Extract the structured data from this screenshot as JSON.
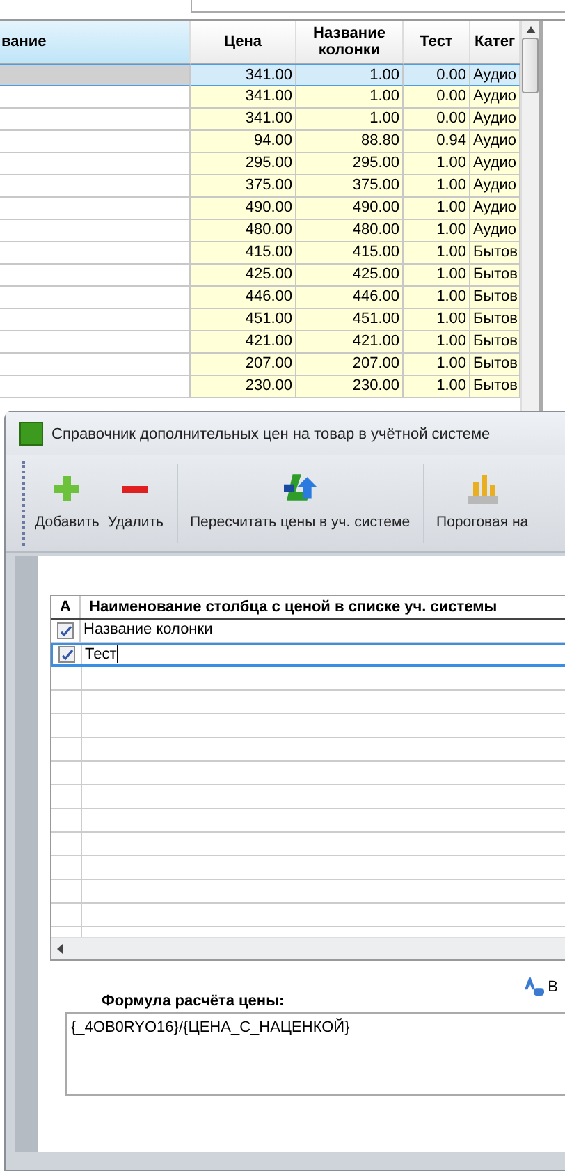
{
  "background_grid": {
    "columns": [
      {
        "label": "вание"
      },
      {
        "label": "Цена"
      },
      {
        "label": "Название колонки"
      },
      {
        "label": "Тест"
      },
      {
        "label": "Катег"
      }
    ],
    "rows": [
      {
        "selected": true,
        "cells": [
          "",
          "341.00",
          "1.00",
          "0.00",
          "Аудио"
        ]
      },
      {
        "selected": false,
        "cells": [
          "",
          "341.00",
          "1.00",
          "0.00",
          "Аудио"
        ]
      },
      {
        "selected": false,
        "cells": [
          "",
          "341.00",
          "1.00",
          "0.00",
          "Аудио"
        ]
      },
      {
        "selected": false,
        "cells": [
          "",
          "94.00",
          "88.80",
          "0.94",
          "Аудио"
        ]
      },
      {
        "selected": false,
        "cells": [
          "",
          "295.00",
          "295.00",
          "1.00",
          "Аудио"
        ]
      },
      {
        "selected": false,
        "cells": [
          "",
          "375.00",
          "375.00",
          "1.00",
          "Аудио"
        ]
      },
      {
        "selected": false,
        "cells": [
          "",
          "490.00",
          "490.00",
          "1.00",
          "Аудио"
        ]
      },
      {
        "selected": false,
        "cells": [
          "",
          "480.00",
          "480.00",
          "1.00",
          "Аудио"
        ]
      },
      {
        "selected": false,
        "cells": [
          "",
          "415.00",
          "415.00",
          "1.00",
          "Бытов"
        ]
      },
      {
        "selected": false,
        "cells": [
          "",
          "425.00",
          "425.00",
          "1.00",
          "Бытов"
        ]
      },
      {
        "selected": false,
        "cells": [
          "",
          "446.00",
          "446.00",
          "1.00",
          "Бытов"
        ]
      },
      {
        "selected": false,
        "cells": [
          "",
          "451.00",
          "451.00",
          "1.00",
          "Бытов"
        ]
      },
      {
        "selected": false,
        "cells": [
          "",
          "421.00",
          "421.00",
          "1.00",
          "Бытов"
        ]
      },
      {
        "selected": false,
        "cells": [
          "",
          "207.00",
          "207.00",
          "1.00",
          "Бытов"
        ]
      },
      {
        "selected": false,
        "cells": [
          "",
          "230.00",
          "230.00",
          "1.00",
          "Бытов"
        ]
      }
    ]
  },
  "dialog": {
    "title": "Справочник дополнительных цен на товар в учётной системе",
    "toolbar": [
      {
        "kind": "add",
        "label": "Добавить"
      },
      {
        "kind": "delete",
        "label": "Удалить"
      },
      {
        "kind": "separator"
      },
      {
        "kind": "recalc",
        "label": "Пересчитать цены в уч. системе"
      },
      {
        "kind": "separator"
      },
      {
        "kind": "threshold",
        "label": "Пороговая на"
      }
    ],
    "grid": {
      "columns": [
        {
          "label": "A"
        },
        {
          "label": "Наименование столбца с ценой в списке уч. системы"
        }
      ],
      "rows": [
        {
          "checked": true,
          "selected": false,
          "name": "Название колонки"
        },
        {
          "checked": true,
          "selected": true,
          "name": "Тест"
        }
      ]
    },
    "side_button": {
      "label": "В"
    },
    "formula": {
      "label": "Формула расчёта цены:",
      "value": "{_4OB0RYO16}/{ЦЕНА_С_НАЦЕНКОЙ}"
    }
  }
}
